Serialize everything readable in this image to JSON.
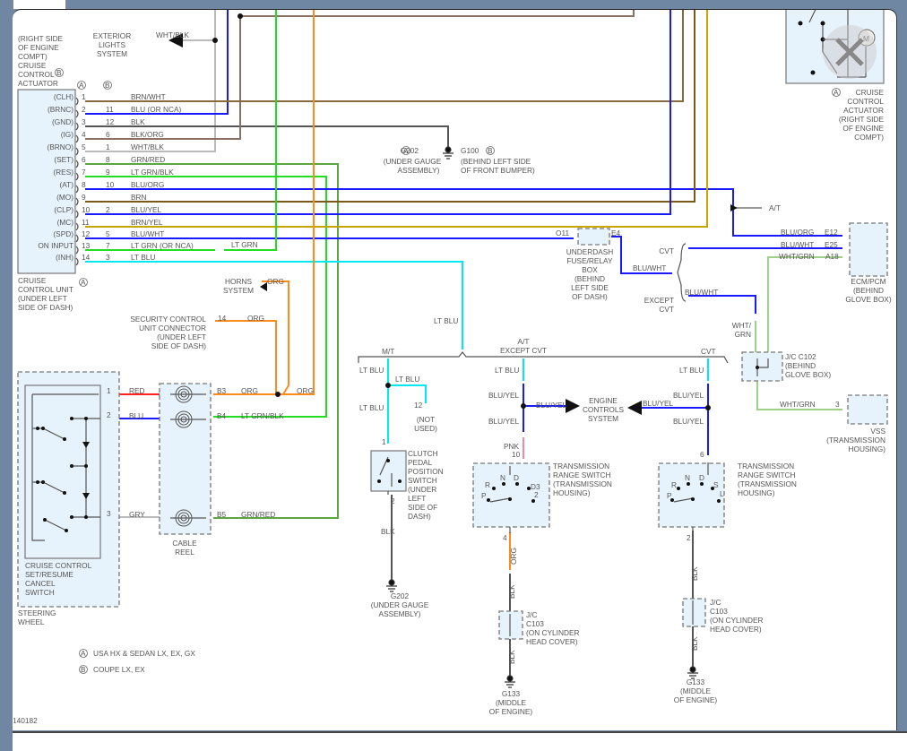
{
  "wire_colors": {
    "BRN_WHT": "#8a6a3c",
    "BLU": "#1a1aff",
    "BLK": "#555555",
    "BLK_ORG": "#8a7060",
    "WHT_BLK": "#bbbbbb",
    "GRN_RED": "#5aa640",
    "LT_GRN": "#22dd22",
    "BLU_ORG": "#1a1aff",
    "BRN": "#7a5a1a",
    "BLU_YEL": "#1a1aff",
    "BRN_YEL": "#c8a400",
    "LT_BLU": "#00e8f0",
    "ORG": "#ff8c1a",
    "RED": "#ff2020",
    "GRY": "#bbbbbb",
    "PNK": "#f08aa0",
    "WHT_GRN": "#9fd08a"
  },
  "diagram_id": "140182",
  "actuator_b_label": [
    "(RIGHT SIDE",
    "OF ENGINE",
    "COMPT)",
    "CRUISE",
    "CONTROL",
    "ACTUATOR"
  ],
  "actuator_a_label": [
    "CRUISE",
    "CONTROL",
    "ACTUATOR",
    "(RIGHT SIDE",
    "OF ENGINE",
    "COMPT)"
  ],
  "exterior_lights": [
    "EXTERIOR",
    "LIGHTS",
    "SYSTEM"
  ],
  "col_a": "A",
  "col_b": "B",
  "rows": [
    {
      "pin": "(CLH)",
      "a": "1",
      "b": "",
      "wire": "BRN/WHT"
    },
    {
      "pin": "(BRNC)",
      "a": "2",
      "b": "11",
      "wire": "BLU (OR NCA)"
    },
    {
      "pin": "(GND)",
      "a": "3",
      "b": "12",
      "wire": "BLK"
    },
    {
      "pin": "(IG)",
      "a": "4",
      "b": "6",
      "wire": "BLK/ORG"
    },
    {
      "pin": "(BRNO)",
      "a": "5",
      "b": "1",
      "wire": "WHT/BLK"
    },
    {
      "pin": "(SET)",
      "a": "6",
      "b": "8",
      "wire": "GRN/RED"
    },
    {
      "pin": "(RES)",
      "a": "7",
      "b": "9",
      "wire": "LT GRN/BLK"
    },
    {
      "pin": "(AT)",
      "a": "8",
      "b": "10",
      "wire": "BLU/ORG"
    },
    {
      "pin": "(MO)",
      "a": "9",
      "b": "",
      "wire": "BRN"
    },
    {
      "pin": "(CLP)",
      "a": "10",
      "b": "2",
      "wire": "BLU/YEL"
    },
    {
      "pin": "(MC)",
      "a": "11",
      "b": "",
      "wire": "BRN/YEL"
    },
    {
      "pin": "(SPD)",
      "a": "12",
      "b": "5",
      "wire": "BLU/WHT"
    },
    {
      "pin": "ON INPUT",
      "a": "13",
      "b": "7",
      "wire": "LT GRN (OR NCA)"
    },
    {
      "pin": "(INH)",
      "a": "14",
      "b": "3",
      "wire": "LT BLU"
    }
  ],
  "labels": {
    "wht_blk": "WHT/BLK",
    "lt_grn": "LT GRN",
    "lt_blu": "LT BLU",
    "at": "A/T",
    "g202_a": "G202",
    "g202_a_loc": [
      "(UNDER GAUGE",
      "ASSEMBLY)"
    ],
    "g100": "G100",
    "g100_loc": [
      "(BEHIND LEFT SIDE",
      "OF FRONT BUMPER)"
    ],
    "cruise_unit": [
      "CRUISE",
      "CONTROL UNIT",
      "(UNDER LEFT",
      "SIDE OF DASH)"
    ],
    "horns": [
      "HORNS",
      "SYSTEM"
    ],
    "org": "ORG",
    "security": [
      "SECURITY CONTROL",
      "UNIT CONNECTOR",
      "(UNDER LEFT",
      "SIDE OF DASH)"
    ],
    "pin14": "14",
    "o11": "O11",
    "e4": "E4",
    "fuse_box": [
      "UNDERDASH",
      "FUSE/RELAY",
      "BOX",
      "(BEHIND",
      "LEFT SIDE",
      "OF DASH)"
    ],
    "blu_wht": "BLU/WHT",
    "cvt": "CVT",
    "except_cvt": [
      "EXCEPT",
      "CVT"
    ],
    "blu_org": "BLU/ORG",
    "e12": "E12",
    "e25": "E25",
    "wht_grn": "WHT/GRN",
    "a18": "A18",
    "ecm": [
      "ECM/PCM",
      "(BEHIND",
      "GLOVE BOX)"
    ],
    "wht_grn_split": [
      "WHT/",
      "GRN"
    ],
    "jc102": [
      "J/C C102",
      "(BEHIND",
      "GLOVE BOX)"
    ],
    "pin3": "3",
    "vss": [
      "VSS",
      "(TRANSMISSION",
      "HOUSING)"
    ],
    "mt": "M/T",
    "at_except": [
      "A/T",
      "EXCEPT CVT"
    ],
    "pin12": "12",
    "not_used": [
      "(NOT",
      "USED)"
    ],
    "pin1": "1",
    "pin2": "2",
    "clutch": [
      "CLUTCH",
      "PEDAL",
      "POSITION",
      "SWITCH",
      "(UNDER",
      "LEFT",
      "SIDE OF",
      "DASH)"
    ],
    "blk": "BLK",
    "g202": "G202",
    "g202_loc": [
      "(UNDER GAUGE",
      "ASSEMBLY)"
    ],
    "blu_yel": "BLU/YEL",
    "engine_controls": [
      "ENGINE",
      "CONTROLS",
      "SYSTEM"
    ],
    "pnk": "PNK",
    "pin10": "10",
    "pin6": "6",
    "pin4": "4",
    "trs": [
      "TRANSMISSION",
      "RANGE SWITCH",
      "(TRANSMISSION",
      "HOUSING)"
    ],
    "gear_a": [
      "R",
      "N",
      "D",
      "D3",
      "P",
      "2"
    ],
    "gear_b": [
      "R",
      "N",
      "D",
      "S",
      "P",
      "L"
    ],
    "jc103": [
      "J/C",
      "C103",
      "(ON CYLINDER",
      "HEAD COVER)"
    ],
    "g133": "G133",
    "g133_loc": [
      "(MIDDLE",
      "OF ENGINE)"
    ],
    "red": "RED",
    "blu": "BLU",
    "gry": "GRY",
    "b3": "B3",
    "b4": "B4",
    "b5": "B5",
    "lt_grn_blk": "LT GRN/BLK",
    "grn_red": "GRN/RED",
    "cable_reel": [
      "CABLE",
      "REEL"
    ],
    "sw": [
      "CRUISE CONTROL",
      "SET/RESUME",
      "CANCEL",
      "SWITCH"
    ],
    "steering": [
      "STEERING",
      "WHEEL"
    ],
    "legend_a": "USA HX & SEDAN LX, EX, GX",
    "legend_b": "COUPE LX, EX",
    "motor": "M"
  }
}
